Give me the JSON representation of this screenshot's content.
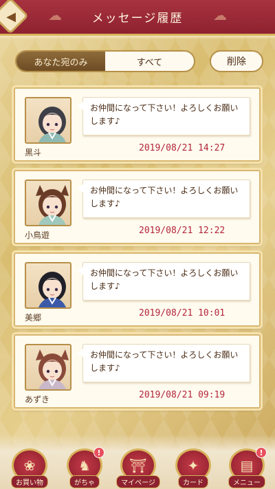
{
  "header": {
    "title": "メッセージ履歴",
    "back_icon": "back-arrow-icon"
  },
  "tabs": [
    {
      "label": "あなた宛のみ",
      "active": true
    },
    {
      "label": "すべて",
      "active": false
    }
  ],
  "delete_label": "削除",
  "messages": [
    {
      "name": "黒斗",
      "text": "お仲間になって下さい！よろしくお願いします♪",
      "time": "2019/08/21 14:27",
      "hair": "#3e3f47",
      "kimono": "#8fb9b3",
      "ears": false
    },
    {
      "name": "小鳥遊",
      "text": "お仲間になって下さい！よろしくお願いします♪",
      "time": "2019/08/21 12:22",
      "hair": "#6a3c28",
      "kimono": "#9fc9bc",
      "ears": true
    },
    {
      "name": "美郷",
      "text": "お仲間になって下さい！よろしくお願いします♪",
      "time": "2019/08/21 10:01",
      "hair": "#1f1f28",
      "kimono": "#3c5aa8",
      "ears": false
    },
    {
      "name": "あずき",
      "text": "お仲間になって下さい！よろしくお願いします♪",
      "time": "2019/08/21 09:19",
      "hair": "#8a4a3a",
      "kimono": "#c9b8c9",
      "ears": true
    }
  ],
  "nav": [
    {
      "label": "お買い物",
      "icon": "shopping-bag-icon",
      "badge": ""
    },
    {
      "label": "がちゃ",
      "icon": "gacha-fox-icon",
      "badge": "!"
    },
    {
      "label": "マイページ",
      "icon": "home-gate-icon",
      "badge": ""
    },
    {
      "label": "カード",
      "icon": "cards-icon",
      "badge": ""
    },
    {
      "label": "メニュー",
      "icon": "menu-book-icon",
      "badge": "!"
    }
  ]
}
